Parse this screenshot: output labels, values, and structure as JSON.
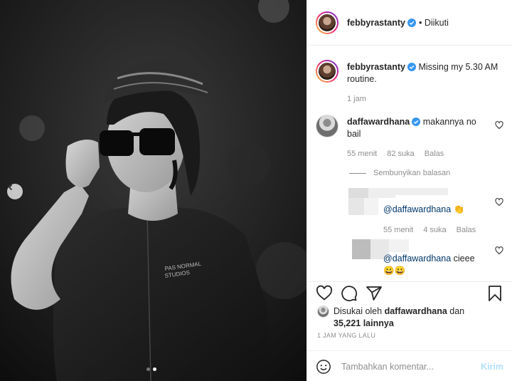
{
  "post": {
    "author": "febbyrastanty",
    "follow_status": "• Diikuti",
    "caption_user": "febbyrastanty",
    "caption_text": "Missing my 5.30 AM routine.",
    "caption_time": "1 jam",
    "photo_dots": 2,
    "active_dot": 2
  },
  "comments": [
    {
      "user": "daffawardhana",
      "text": "makannya no bail",
      "time": "55 menit",
      "likes": "82 suka",
      "reply_label": "Balas"
    }
  ],
  "hide_replies_label": "Sembunyikan balasan",
  "replies": [
    {
      "mention": "@daffawardhana",
      "text": "👏",
      "time": "55 menit",
      "likes": "4 suka",
      "reply_label": "Balas"
    },
    {
      "mention": "@daffawardhana",
      "text": "cieee",
      "emoji": "😀😀"
    }
  ],
  "likes_summary": {
    "prefix": "Disukai oleh",
    "user": "daffawardhana",
    "suffix": "dan",
    "others": "35,221 lainnya"
  },
  "time_ago": "1 JAM YANG LALU",
  "comment_input": {
    "placeholder": "Tambahkan komentar...",
    "post_label": "Kirim"
  },
  "icons": [
    "chevron-left-icon",
    "verified-icon",
    "heart-icon",
    "comment-icon",
    "share-icon",
    "bookmark-icon",
    "emoji-icon"
  ],
  "colors": {
    "verified": "#3897f0",
    "post_button": "#b2dffc",
    "muted_text": "#8e8e8e",
    "mention": "#00376b"
  }
}
